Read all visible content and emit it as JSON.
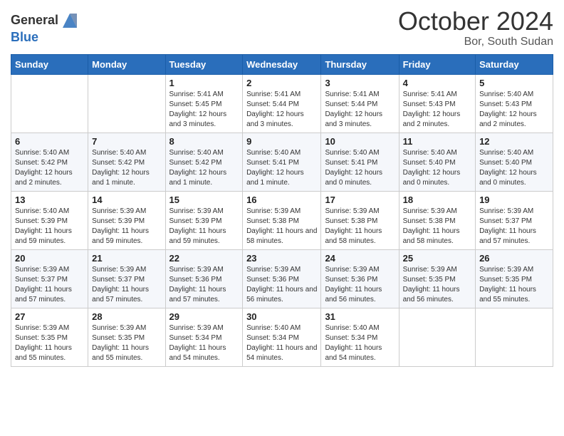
{
  "logo": {
    "line1": "General",
    "line2": "Blue"
  },
  "header": {
    "month": "October 2024",
    "location": "Bor, South Sudan"
  },
  "days_of_week": [
    "Sunday",
    "Monday",
    "Tuesday",
    "Wednesday",
    "Thursday",
    "Friday",
    "Saturday"
  ],
  "weeks": [
    [
      {
        "day": "",
        "info": ""
      },
      {
        "day": "",
        "info": ""
      },
      {
        "day": "1",
        "info": "Sunrise: 5:41 AM\nSunset: 5:45 PM\nDaylight: 12 hours and 3 minutes."
      },
      {
        "day": "2",
        "info": "Sunrise: 5:41 AM\nSunset: 5:44 PM\nDaylight: 12 hours and 3 minutes."
      },
      {
        "day": "3",
        "info": "Sunrise: 5:41 AM\nSunset: 5:44 PM\nDaylight: 12 hours and 3 minutes."
      },
      {
        "day": "4",
        "info": "Sunrise: 5:41 AM\nSunset: 5:43 PM\nDaylight: 12 hours and 2 minutes."
      },
      {
        "day": "5",
        "info": "Sunrise: 5:40 AM\nSunset: 5:43 PM\nDaylight: 12 hours and 2 minutes."
      }
    ],
    [
      {
        "day": "6",
        "info": "Sunrise: 5:40 AM\nSunset: 5:42 PM\nDaylight: 12 hours and 2 minutes."
      },
      {
        "day": "7",
        "info": "Sunrise: 5:40 AM\nSunset: 5:42 PM\nDaylight: 12 hours and 1 minute."
      },
      {
        "day": "8",
        "info": "Sunrise: 5:40 AM\nSunset: 5:42 PM\nDaylight: 12 hours and 1 minute."
      },
      {
        "day": "9",
        "info": "Sunrise: 5:40 AM\nSunset: 5:41 PM\nDaylight: 12 hours and 1 minute."
      },
      {
        "day": "10",
        "info": "Sunrise: 5:40 AM\nSunset: 5:41 PM\nDaylight: 12 hours and 0 minutes."
      },
      {
        "day": "11",
        "info": "Sunrise: 5:40 AM\nSunset: 5:40 PM\nDaylight: 12 hours and 0 minutes."
      },
      {
        "day": "12",
        "info": "Sunrise: 5:40 AM\nSunset: 5:40 PM\nDaylight: 12 hours and 0 minutes."
      }
    ],
    [
      {
        "day": "13",
        "info": "Sunrise: 5:40 AM\nSunset: 5:39 PM\nDaylight: 11 hours and 59 minutes."
      },
      {
        "day": "14",
        "info": "Sunrise: 5:39 AM\nSunset: 5:39 PM\nDaylight: 11 hours and 59 minutes."
      },
      {
        "day": "15",
        "info": "Sunrise: 5:39 AM\nSunset: 5:39 PM\nDaylight: 11 hours and 59 minutes."
      },
      {
        "day": "16",
        "info": "Sunrise: 5:39 AM\nSunset: 5:38 PM\nDaylight: 11 hours and 58 minutes."
      },
      {
        "day": "17",
        "info": "Sunrise: 5:39 AM\nSunset: 5:38 PM\nDaylight: 11 hours and 58 minutes."
      },
      {
        "day": "18",
        "info": "Sunrise: 5:39 AM\nSunset: 5:38 PM\nDaylight: 11 hours and 58 minutes."
      },
      {
        "day": "19",
        "info": "Sunrise: 5:39 AM\nSunset: 5:37 PM\nDaylight: 11 hours and 57 minutes."
      }
    ],
    [
      {
        "day": "20",
        "info": "Sunrise: 5:39 AM\nSunset: 5:37 PM\nDaylight: 11 hours and 57 minutes."
      },
      {
        "day": "21",
        "info": "Sunrise: 5:39 AM\nSunset: 5:37 PM\nDaylight: 11 hours and 57 minutes."
      },
      {
        "day": "22",
        "info": "Sunrise: 5:39 AM\nSunset: 5:36 PM\nDaylight: 11 hours and 57 minutes."
      },
      {
        "day": "23",
        "info": "Sunrise: 5:39 AM\nSunset: 5:36 PM\nDaylight: 11 hours and 56 minutes."
      },
      {
        "day": "24",
        "info": "Sunrise: 5:39 AM\nSunset: 5:36 PM\nDaylight: 11 hours and 56 minutes."
      },
      {
        "day": "25",
        "info": "Sunrise: 5:39 AM\nSunset: 5:35 PM\nDaylight: 11 hours and 56 minutes."
      },
      {
        "day": "26",
        "info": "Sunrise: 5:39 AM\nSunset: 5:35 PM\nDaylight: 11 hours and 55 minutes."
      }
    ],
    [
      {
        "day": "27",
        "info": "Sunrise: 5:39 AM\nSunset: 5:35 PM\nDaylight: 11 hours and 55 minutes."
      },
      {
        "day": "28",
        "info": "Sunrise: 5:39 AM\nSunset: 5:35 PM\nDaylight: 11 hours and 55 minutes."
      },
      {
        "day": "29",
        "info": "Sunrise: 5:39 AM\nSunset: 5:34 PM\nDaylight: 11 hours and 54 minutes."
      },
      {
        "day": "30",
        "info": "Sunrise: 5:40 AM\nSunset: 5:34 PM\nDaylight: 11 hours and 54 minutes."
      },
      {
        "day": "31",
        "info": "Sunrise: 5:40 AM\nSunset: 5:34 PM\nDaylight: 11 hours and 54 minutes."
      },
      {
        "day": "",
        "info": ""
      },
      {
        "day": "",
        "info": ""
      }
    ]
  ]
}
